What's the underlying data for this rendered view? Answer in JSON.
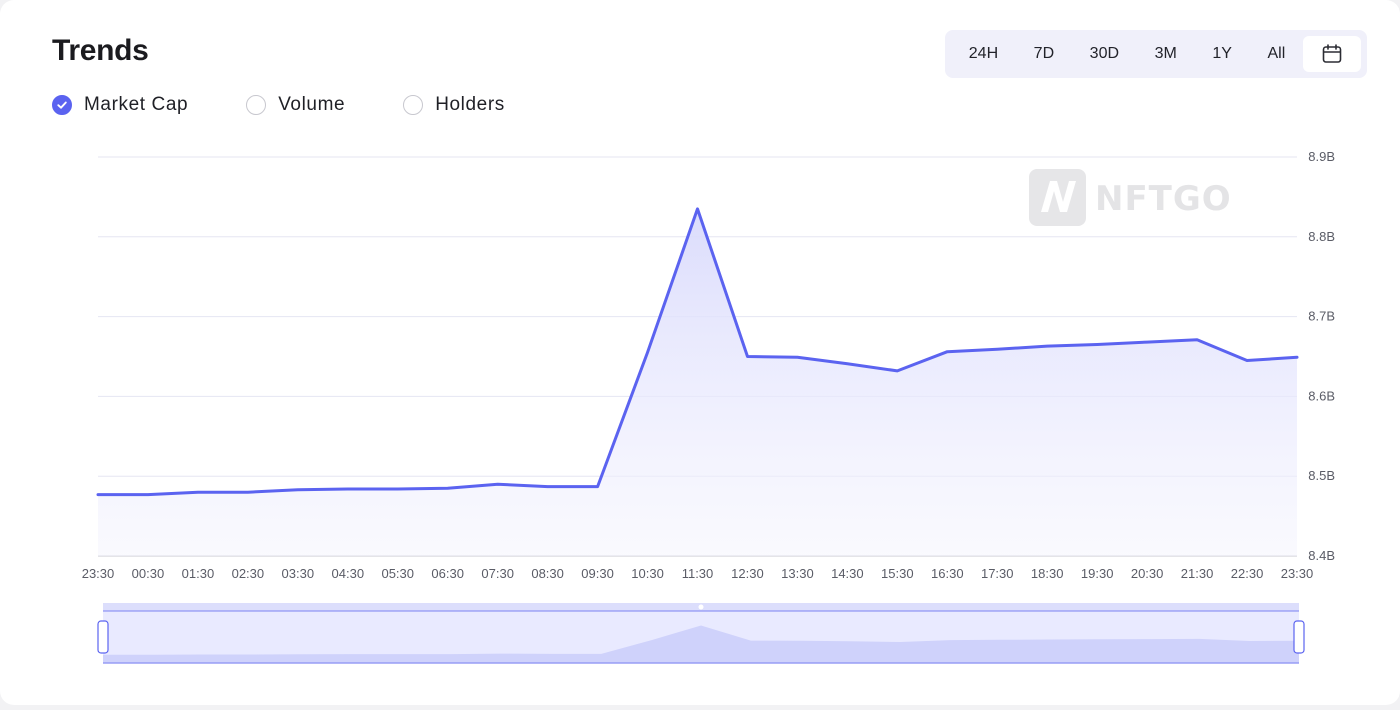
{
  "header": {
    "title": "Trends"
  },
  "range_buttons": [
    {
      "label": "24H"
    },
    {
      "label": "7D"
    },
    {
      "label": "30D"
    },
    {
      "label": "3M"
    },
    {
      "label": "1Y"
    },
    {
      "label": "All"
    }
  ],
  "calendar_icon": "calendar-icon",
  "metric_toggles": [
    {
      "label": "Market Cap",
      "checked": true
    },
    {
      "label": "Volume",
      "checked": false
    },
    {
      "label": "Holders",
      "checked": false
    }
  ],
  "watermark": {
    "text": "NFTGO",
    "icon": "nftgo-logo-icon"
  },
  "colors": {
    "line": "#5b63f0",
    "area": "#e6e7fd",
    "grid": "#e5e6f2",
    "accent": "#5b63f0"
  },
  "chart_data": {
    "type": "area",
    "x": [
      "23:30",
      "00:30",
      "01:30",
      "02:30",
      "03:30",
      "04:30",
      "05:30",
      "06:30",
      "07:30",
      "08:30",
      "09:30",
      "10:30",
      "11:30",
      "12:30",
      "13:30",
      "14:30",
      "15:30",
      "16:30",
      "17:30",
      "18:30",
      "19:30",
      "20:30",
      "21:30",
      "22:30",
      "23:30"
    ],
    "series": [
      {
        "values": [
          8.477,
          8.477,
          8.48,
          8.48,
          8.483,
          8.484,
          8.484,
          8.485,
          8.49,
          8.487,
          8.487,
          8.655,
          8.835,
          8.65,
          8.649,
          8.641,
          8.632,
          8.656,
          8.659,
          8.663,
          8.665,
          8.668,
          8.671,
          8.645,
          8.649
        ]
      }
    ],
    "y_ticks": [
      "8.4B",
      "8.5B",
      "8.6B",
      "8.7B",
      "8.8B",
      "8.9B"
    ],
    "ylim": [
      8.4,
      8.9
    ],
    "grid": true,
    "y_axis_position": "right",
    "range_slider": true
  }
}
